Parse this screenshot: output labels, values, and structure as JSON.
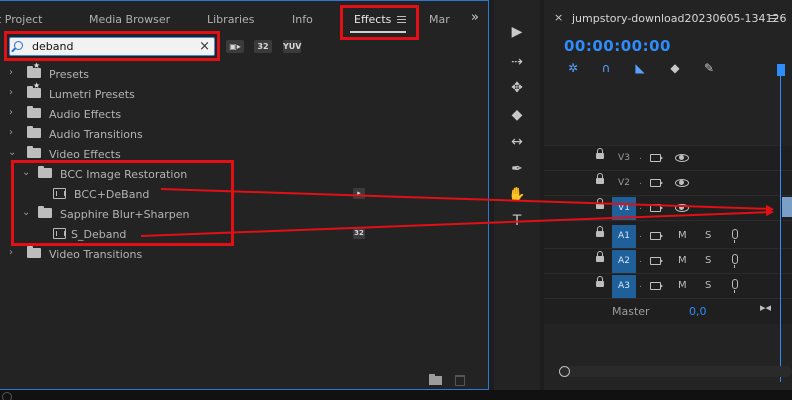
{
  "effects_panel": {
    "tabs": [
      {
        "label": "t Project",
        "active": false
      },
      {
        "label": "Media Browser",
        "active": false
      },
      {
        "label": "Libraries",
        "active": false
      },
      {
        "label": "Info",
        "active": false
      },
      {
        "label": "Effects",
        "active": true
      },
      {
        "label": "Mar",
        "active": false
      }
    ],
    "overflow_glyph": "»",
    "search": {
      "value": "deband",
      "placeholder": ""
    },
    "filter_badges": [
      "32",
      "YUV"
    ],
    "tree": [
      {
        "label": "Presets",
        "type": "folder",
        "expanded": false,
        "level": 0,
        "icon": "folder-star"
      },
      {
        "label": "Lumetri Presets",
        "type": "folder",
        "expanded": false,
        "level": 0,
        "icon": "folder-star"
      },
      {
        "label": "Audio Effects",
        "type": "folder",
        "expanded": false,
        "level": 0,
        "icon": "folder"
      },
      {
        "label": "Audio Transitions",
        "type": "folder",
        "expanded": false,
        "level": 0,
        "icon": "folder"
      },
      {
        "label": "Video Effects",
        "type": "folder",
        "expanded": true,
        "level": 0,
        "icon": "folder"
      },
      {
        "label": "BCC Image Restoration",
        "type": "folder",
        "expanded": true,
        "level": 1,
        "icon": "folder"
      },
      {
        "label": "BCC+DeBand",
        "type": "effect",
        "level": 2,
        "badge": "accelerated"
      },
      {
        "label": "Sapphire Blur+Sharpen",
        "type": "folder",
        "expanded": true,
        "level": 1,
        "icon": "folder"
      },
      {
        "label": "S_Deband",
        "type": "effect",
        "level": 2,
        "badge": "32"
      },
      {
        "label": "Video Transitions",
        "type": "folder",
        "expanded": false,
        "level": 0,
        "icon": "folder"
      }
    ]
  },
  "timeline": {
    "sequence_title": "jumpstory-download20230605-134126",
    "close_glyph": "×",
    "timecode": "00:00:00:00",
    "tracks": [
      {
        "name": "V3",
        "kind": "video",
        "targeted": false
      },
      {
        "name": "V2",
        "kind": "video",
        "targeted": false
      },
      {
        "name": "V1",
        "kind": "video",
        "targeted": true
      },
      {
        "name": "A1",
        "kind": "audio",
        "targeted": true
      },
      {
        "name": "A2",
        "kind": "audio",
        "targeted": true
      },
      {
        "name": "A3",
        "kind": "audio",
        "targeted": true
      }
    ],
    "mute_label": "M",
    "solo_label": "S",
    "master_label": "Master",
    "master_value": "0,0"
  },
  "colors": {
    "accent": "#2f8cff",
    "annotation_red": "#e20f14",
    "panel_bg": "#232323",
    "targeted_track": "#1f5f9a"
  }
}
